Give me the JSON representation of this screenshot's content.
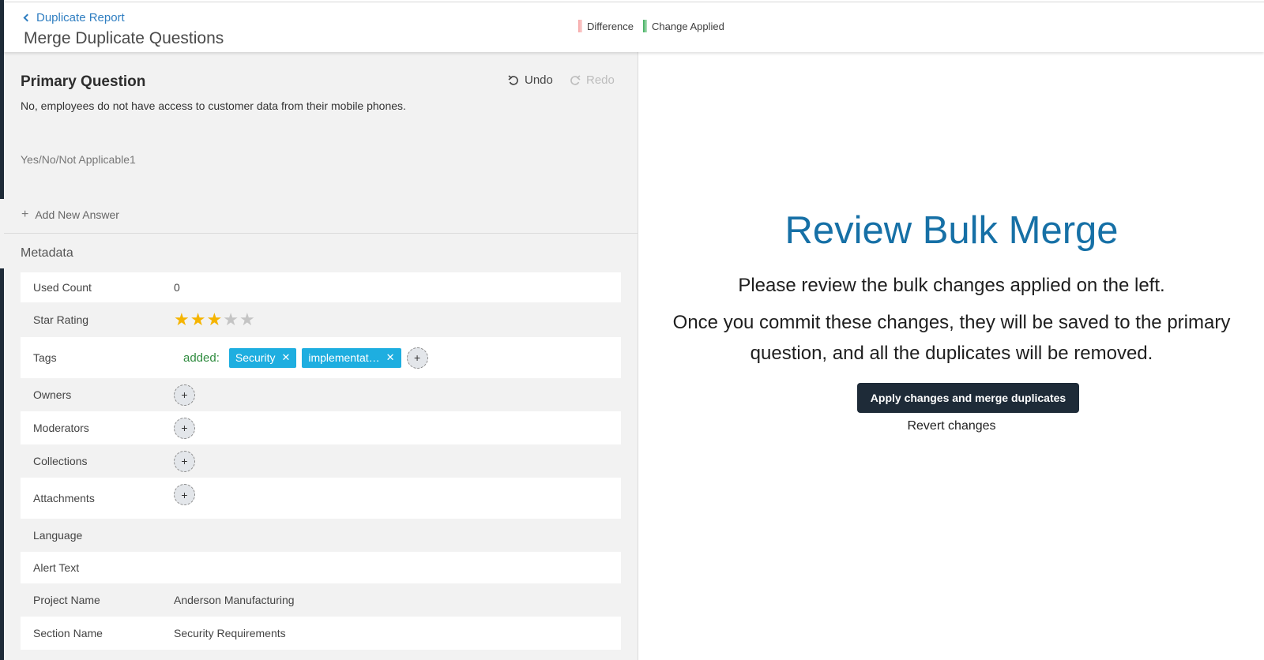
{
  "header": {
    "back_label": "Duplicate Report",
    "title": "Merge Duplicate Questions",
    "legend": {
      "difference": "Difference",
      "change_applied": "Change Applied"
    }
  },
  "primary": {
    "title": "Primary Question",
    "undo": "Undo",
    "redo": "Redo",
    "question_text": "No, employees do not have access to customer data from their mobile phones.",
    "answer_type": "Yes/No/Not Applicable1",
    "add_answer": "Add New Answer"
  },
  "metadata": {
    "title": "Metadata",
    "used_count": {
      "label": "Used Count",
      "value": "0"
    },
    "star_rating": {
      "label": "Star Rating",
      "rating": 3,
      "max": 5
    },
    "tags": {
      "label": "Tags",
      "added_label": "added:",
      "items": [
        "Security",
        "implementat…"
      ]
    },
    "owners": {
      "label": "Owners"
    },
    "moderators": {
      "label": "Moderators"
    },
    "collections": {
      "label": "Collections"
    },
    "attachments": {
      "label": "Attachments"
    },
    "language": {
      "label": "Language",
      "value": ""
    },
    "alert_text": {
      "label": "Alert Text",
      "value": ""
    },
    "project_name": {
      "label": "Project Name",
      "value": "Anderson Manufacturing"
    },
    "section_name": {
      "label": "Section Name",
      "value": "Security Requirements"
    }
  },
  "review": {
    "title": "Review Bulk Merge",
    "line1": "Please review the bulk changes applied on the left.",
    "line2": "Once you commit these changes, they will be saved to the primary question, and all the duplicates will be removed.",
    "apply_button": "Apply changes and merge duplicates",
    "revert": "Revert changes"
  },
  "colors": {
    "accent": "#1670a6",
    "dark": "#1e2b38",
    "tag": "#1eaee0",
    "star": "#f5b400",
    "added": "#2e8b3e"
  }
}
